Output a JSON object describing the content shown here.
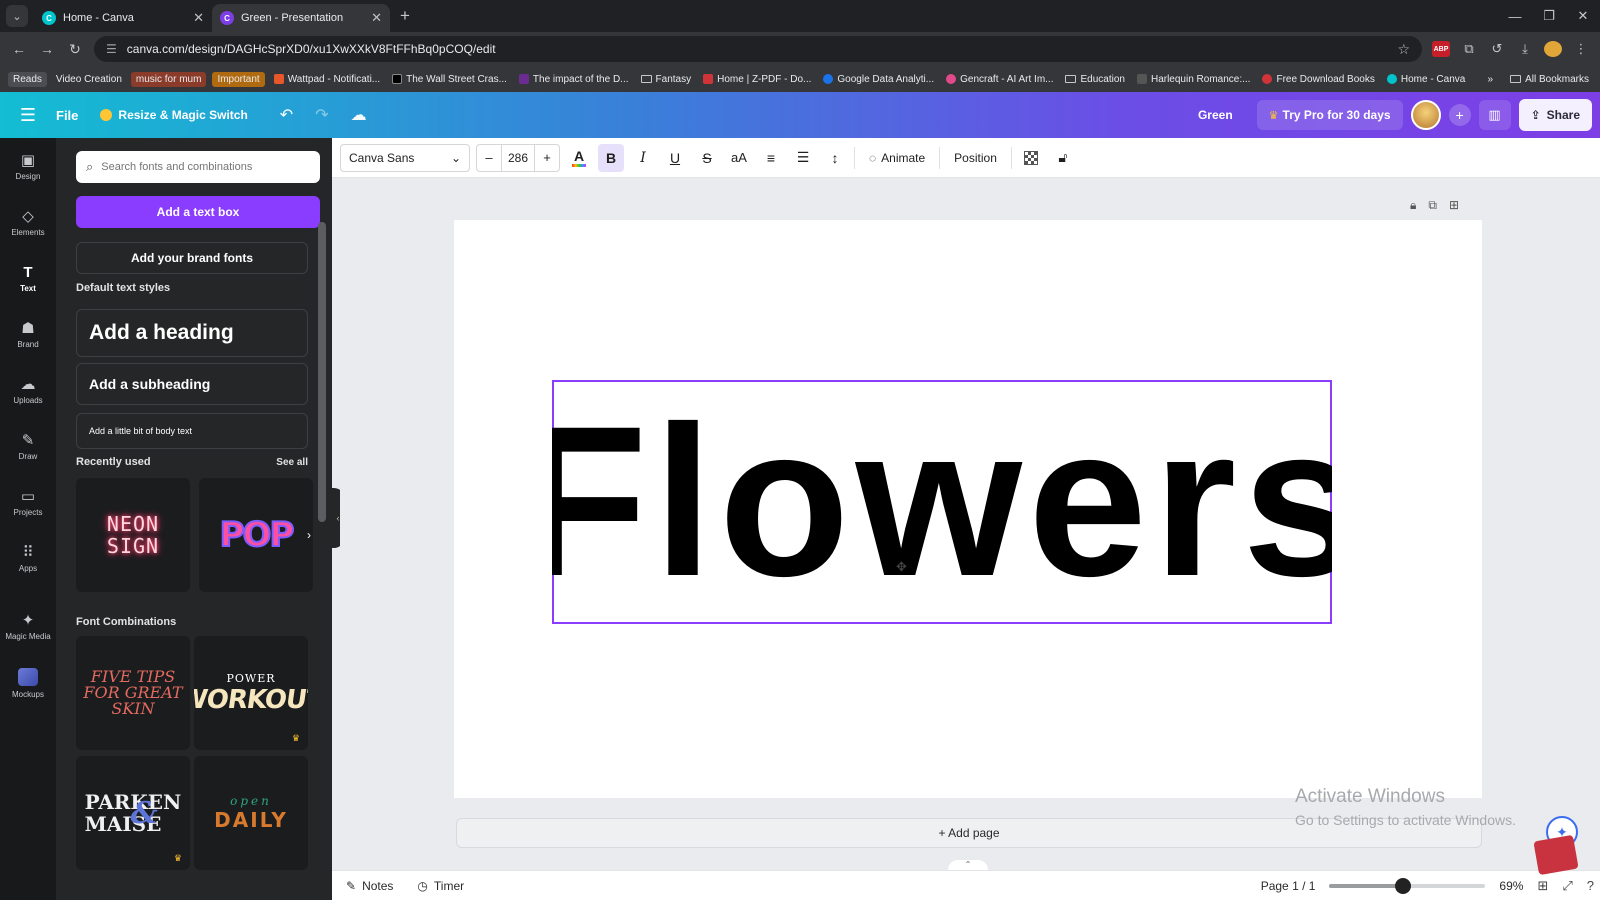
{
  "browser": {
    "tabs": [
      {
        "title": "Home - Canva",
        "active": false
      },
      {
        "title": "Green - Presentation",
        "active": true
      }
    ],
    "url": "canva.com/design/DAGHcSprXD0/xu1XwXXkV8FtFFhBq0pCOQ/edit",
    "bookmarks": [
      {
        "label": "Reads",
        "color": "#4a4d52"
      },
      {
        "label": "Video Creation",
        "color": ""
      },
      {
        "label": "music for mum",
        "color": "#8a3b2a"
      },
      {
        "label": "Important",
        "color": "#b06a10"
      },
      {
        "label": "Wattpad - Notificati...",
        "icon": "#e8572a"
      },
      {
        "label": "The Wall Street Cras...",
        "icon": "#000000"
      },
      {
        "label": "The impact of the D...",
        "icon": "#6b2c91"
      },
      {
        "label": "Fantasy",
        "icon": "folder"
      },
      {
        "label": "Home | Z-PDF - Do...",
        "icon": "#d13438"
      },
      {
        "label": "Google Data Analyti...",
        "icon": "#1a73e8"
      },
      {
        "label": "Gencraft - AI Art Im...",
        "icon": "#e04a8a"
      },
      {
        "label": "Education",
        "icon": "folder"
      },
      {
        "label": "Harlequin Romance:...",
        "icon": "#555555"
      },
      {
        "label": "Free Download Books",
        "icon": "#d13438"
      },
      {
        "label": "Home - Canva",
        "icon": "#00c4cc"
      }
    ],
    "all_bookmarks": "All Bookmarks"
  },
  "header": {
    "file": "File",
    "resize": "Resize & Magic Switch",
    "doc_name": "Green",
    "try_pro": "Try Pro for 30 days",
    "share": "Share"
  },
  "rail": [
    {
      "label": "Design",
      "icon": "design-icon",
      "glyph": "▣"
    },
    {
      "label": "Elements",
      "icon": "elements-icon",
      "glyph": "◇"
    },
    {
      "label": "Text",
      "icon": "text-icon",
      "glyph": "T",
      "active": true
    },
    {
      "label": "Brand",
      "icon": "brand-icon",
      "glyph": "☗"
    },
    {
      "label": "Uploads",
      "icon": "uploads-icon",
      "glyph": "☁"
    },
    {
      "label": "Draw",
      "icon": "draw-icon",
      "glyph": "✎"
    },
    {
      "label": "Projects",
      "icon": "projects-icon",
      "glyph": "▭"
    },
    {
      "label": "Apps",
      "icon": "apps-icon",
      "glyph": "⠿"
    },
    {
      "label": "Magic Media",
      "icon": "magic-media-icon",
      "glyph": "✦"
    },
    {
      "label": "Mockups",
      "icon": "mockups-icon",
      "glyph": ""
    }
  ],
  "panel": {
    "search_placeholder": "Search fonts and combinations",
    "add_text_box": "Add a text box",
    "add_brand_fonts": "Add your brand fonts",
    "default_styles_title": "Default text styles",
    "heading": "Add a heading",
    "subheading": "Add a subheading",
    "body": "Add a little bit of body text",
    "recently_used": "Recently used",
    "see_all": "See all",
    "recent": {
      "neon_line1": "NEON",
      "neon_line2": "SIGN",
      "pop": "POP"
    },
    "font_combinations": "Font Combinations",
    "combos": {
      "c1": "FIVE TIPS FOR GREAT SKIN",
      "c2a": "POWER",
      "c2b": "WORKOUT",
      "c3a": "PARKEN",
      "c3b": "MAISE",
      "c3c": "&",
      "c4a": "open",
      "c4b": "DAILY"
    }
  },
  "toolbar": {
    "font": "Canva Sans",
    "size": "286",
    "animate": "Animate",
    "position": "Position"
  },
  "canvas": {
    "text": "Flowers",
    "add_page": "+ Add page"
  },
  "watermark": {
    "line1": "Activate Windows",
    "line2": "Go to Settings to activate Windows."
  },
  "bottom": {
    "notes": "Notes",
    "timer": "Timer",
    "page": "Page 1 / 1",
    "zoom_label": "69%",
    "zoom_fraction": 0.47
  },
  "colors": {
    "canva_purple": "#8b3dff",
    "rail_bg": "#18191b",
    "panel_bg": "#252627"
  }
}
